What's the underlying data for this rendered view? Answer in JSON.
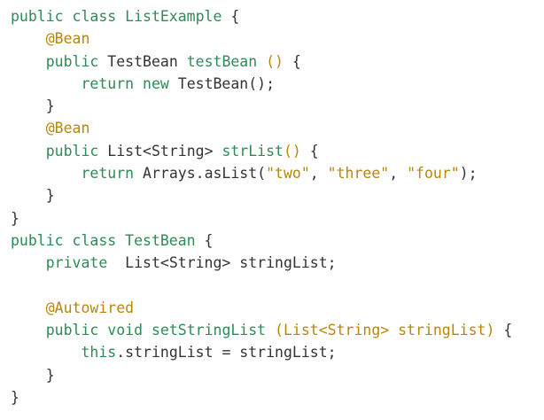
{
  "code": {
    "lines": [
      [
        {
          "t": "public class ",
          "c": "kw"
        },
        {
          "t": "ListExample",
          "c": "fn"
        },
        {
          "t": " {",
          "c": "plain"
        }
      ],
      [
        {
          "t": "    ",
          "c": "plain"
        },
        {
          "t": "@Bean",
          "c": "ann"
        }
      ],
      [
        {
          "t": "    ",
          "c": "plain"
        },
        {
          "t": "public ",
          "c": "kw"
        },
        {
          "t": "TestBean ",
          "c": "type"
        },
        {
          "t": "testBean",
          "c": "fn"
        },
        {
          "t": " ()",
          "c": "punct"
        },
        {
          "t": " {",
          "c": "plain"
        }
      ],
      [
        {
          "t": "        ",
          "c": "plain"
        },
        {
          "t": "return new ",
          "c": "kw"
        },
        {
          "t": "TestBean();",
          "c": "plain"
        }
      ],
      [
        {
          "t": "    }",
          "c": "plain"
        }
      ],
      [
        {
          "t": "    ",
          "c": "plain"
        },
        {
          "t": "@Bean",
          "c": "ann"
        }
      ],
      [
        {
          "t": "    ",
          "c": "plain"
        },
        {
          "t": "public ",
          "c": "kw"
        },
        {
          "t": "List<String> ",
          "c": "type"
        },
        {
          "t": "strList",
          "c": "fn"
        },
        {
          "t": "()",
          "c": "punct"
        },
        {
          "t": " {",
          "c": "plain"
        }
      ],
      [
        {
          "t": "        ",
          "c": "plain"
        },
        {
          "t": "return ",
          "c": "kw"
        },
        {
          "t": "Arrays.asList(",
          "c": "plain"
        },
        {
          "t": "\"two\"",
          "c": "str"
        },
        {
          "t": ", ",
          "c": "plain"
        },
        {
          "t": "\"three\"",
          "c": "str"
        },
        {
          "t": ", ",
          "c": "plain"
        },
        {
          "t": "\"four\"",
          "c": "str"
        },
        {
          "t": ");",
          "c": "plain"
        }
      ],
      [
        {
          "t": "    }",
          "c": "plain"
        }
      ],
      [
        {
          "t": "}",
          "c": "plain"
        }
      ],
      [
        {
          "t": "public class ",
          "c": "kw"
        },
        {
          "t": "TestBean",
          "c": "fn"
        },
        {
          "t": " {",
          "c": "plain"
        }
      ],
      [
        {
          "t": "    ",
          "c": "plain"
        },
        {
          "t": "private  ",
          "c": "kw"
        },
        {
          "t": "List<String> stringList;",
          "c": "plain"
        }
      ],
      [
        {
          "t": "",
          "c": "plain"
        }
      ],
      [
        {
          "t": "    ",
          "c": "plain"
        },
        {
          "t": "@Autowired",
          "c": "ann"
        }
      ],
      [
        {
          "t": "    ",
          "c": "plain"
        },
        {
          "t": "public void ",
          "c": "kw"
        },
        {
          "t": "setStringList",
          "c": "fn"
        },
        {
          "t": " (",
          "c": "punct"
        },
        {
          "t": "List<String> stringList",
          "c": "ann"
        },
        {
          "t": ")",
          "c": "punct"
        },
        {
          "t": " {",
          "c": "plain"
        }
      ],
      [
        {
          "t": "        ",
          "c": "plain"
        },
        {
          "t": "this",
          "c": "kw"
        },
        {
          "t": ".stringList = stringList;",
          "c": "plain"
        }
      ],
      [
        {
          "t": "    }",
          "c": "plain"
        }
      ],
      [
        {
          "t": "}",
          "c": "plain"
        }
      ]
    ]
  },
  "colors": {
    "keyword": "#2e8b57",
    "function": "#2e8b57",
    "annotation": "#b8860b",
    "string": "#b8860b",
    "plain": "#333333",
    "background": "#ffffff"
  }
}
